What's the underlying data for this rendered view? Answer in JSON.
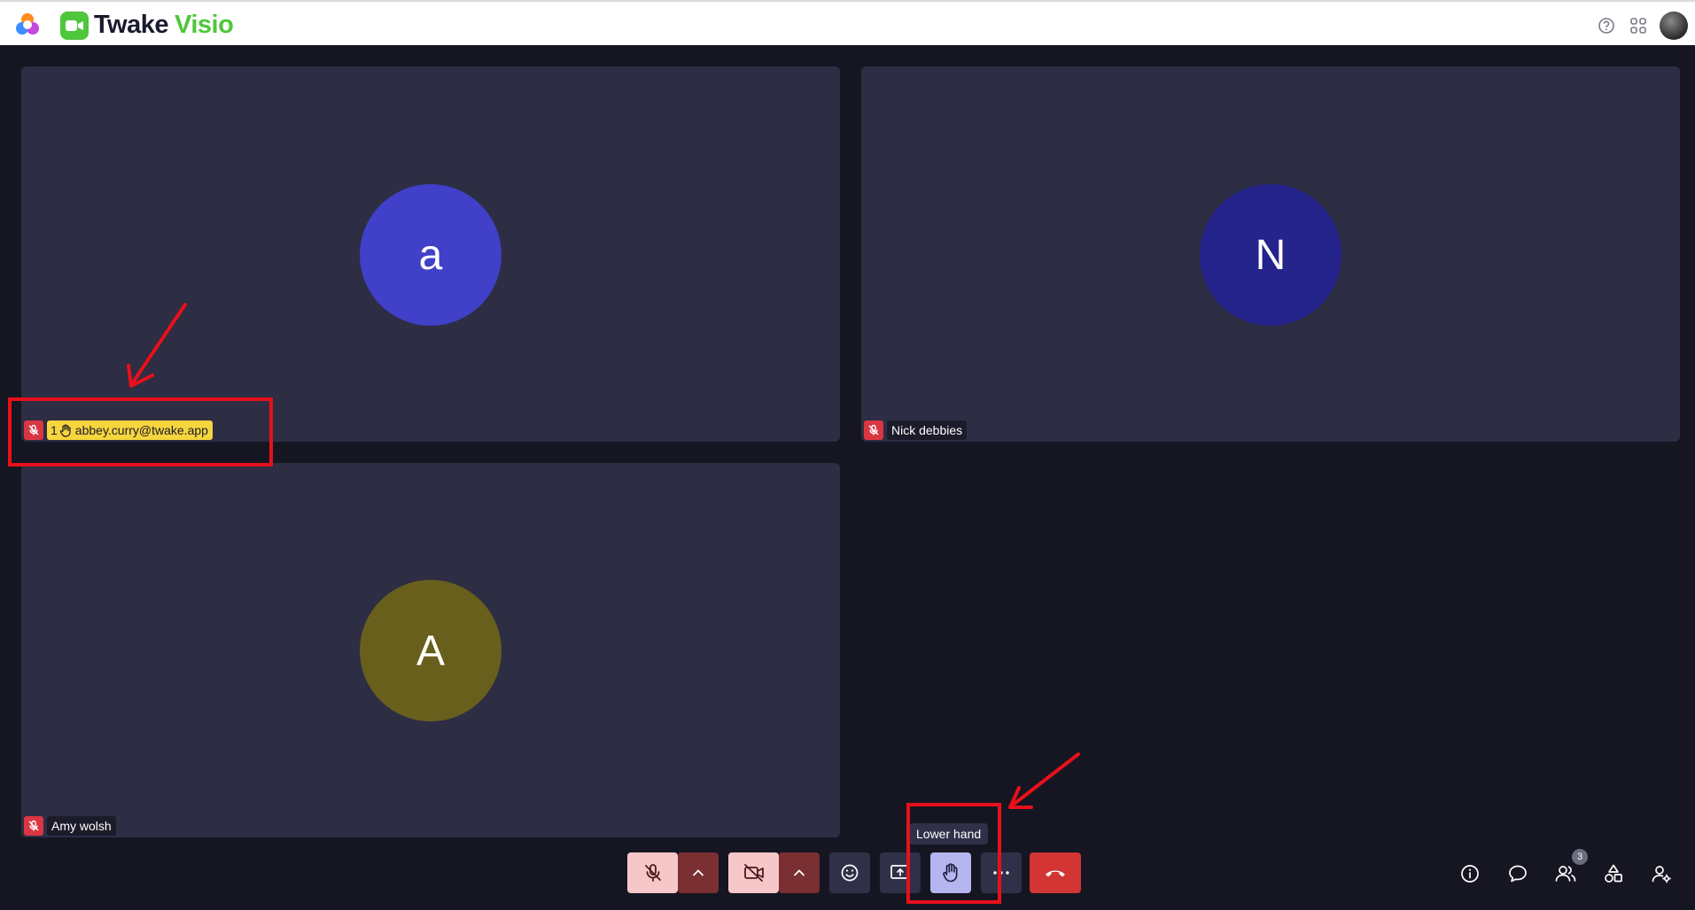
{
  "header": {
    "brand_name": "Twake",
    "brand_accent": "Visio",
    "icons": [
      "help-icon",
      "apps-grid-icon"
    ]
  },
  "tiles": [
    {
      "initial": "a",
      "avatar_color": "#4040c8",
      "name": "abbey.curry@twake.app",
      "hand_count": "1",
      "hand_raised": true,
      "muted": true
    },
    {
      "initial": "N",
      "avatar_color": "#24248c",
      "name": "Nick debbies",
      "hand_raised": false,
      "muted": true
    },
    {
      "initial": "A",
      "avatar_color": "#685f1c",
      "name": "Amy wolsh",
      "hand_raised": false,
      "muted": true
    }
  ],
  "controls": {
    "tooltip": "Lower hand",
    "participants_count": "3",
    "buttons": [
      "mic-muted-icon",
      "chevron-up-icon",
      "video-off-icon",
      "chevron-up-icon",
      "emoji-icon",
      "screen-share-icon",
      "hand-icon",
      "more-icon",
      "hang-up-icon"
    ],
    "side_buttons": [
      "info-icon",
      "chat-icon",
      "participants-icon",
      "tools-icon",
      "admin-icon"
    ]
  },
  "colors": {
    "background": "#161622",
    "tile": "#2d2d44",
    "accent": "#4fc63b",
    "mute_red": "#d93642",
    "hand_yellow": "#f6d53d",
    "annotation_red": "#e8101a"
  }
}
